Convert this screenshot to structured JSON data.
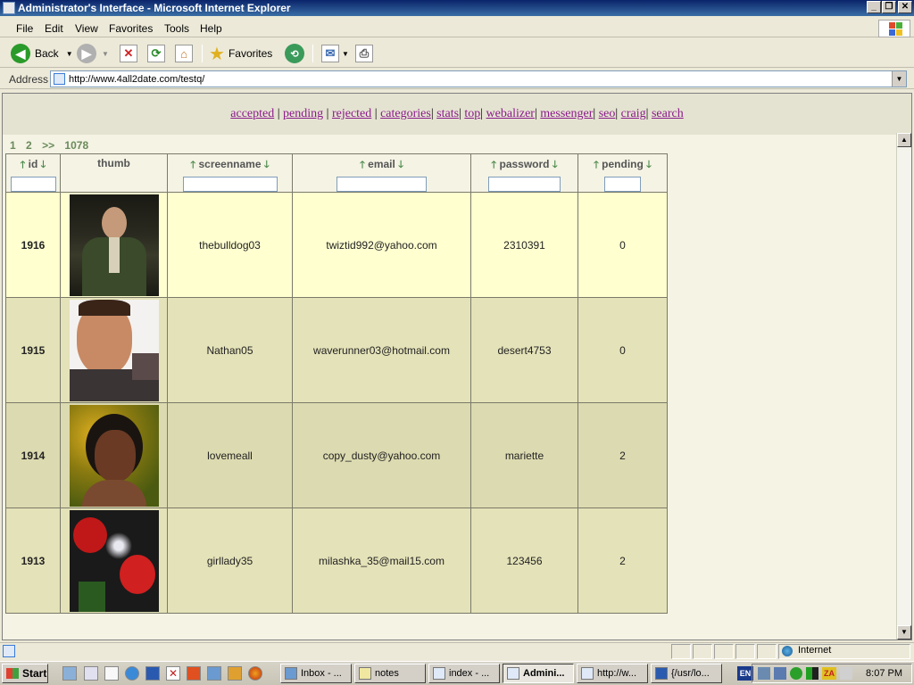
{
  "window": {
    "title": "Administrator's Interface - Microsoft Internet Explorer"
  },
  "menu": [
    "File",
    "Edit",
    "View",
    "Favorites",
    "Tools",
    "Help"
  ],
  "toolbar": {
    "back_label": "Back",
    "favorites_label": "Favorites"
  },
  "address": {
    "label": "Address",
    "url": "http://www.4all2date.com/testq/"
  },
  "nav_links": [
    "accepted",
    "pending",
    "rejected",
    "categories",
    "stats",
    "top",
    "webalizer",
    "messenger",
    "seo",
    "craig",
    "search"
  ],
  "pager": [
    "1",
    "2",
    ">>",
    "1078"
  ],
  "table": {
    "columns": [
      "id",
      "thumb",
      "screenname",
      "email",
      "password",
      "pending"
    ],
    "rows": [
      {
        "id": "1916",
        "thumb": "man-in-uniform-photo",
        "screenname": "thebulldog03",
        "email": "twiztid992@yahoo.com",
        "password": "2310391",
        "pending": "0"
      },
      {
        "id": "1915",
        "thumb": "man-portrait-photo",
        "screenname": "Nathan05",
        "email": "waverunner03@hotmail.com",
        "password": "desert4753",
        "pending": "0"
      },
      {
        "id": "1914",
        "thumb": "woman-portrait-photo",
        "screenname": "lovemeall",
        "email": "copy_dusty@yahoo.com",
        "password": "mariette",
        "pending": "2"
      },
      {
        "id": "1913",
        "thumb": "red-roses-photo",
        "screenname": "girllady35",
        "email": "milashka_35@mail15.com",
        "password": "123456",
        "pending": "2"
      }
    ],
    "row_colors": [
      "#ffffd0",
      "#e4e2b8",
      "#dcdab0",
      "#e4e2b8"
    ]
  },
  "status": {
    "zone": "Internet"
  },
  "taskbar": {
    "start_label": "Start",
    "tasks": [
      "Inbox - ...",
      "notes",
      "index - ...",
      "Admini...",
      "http://w...",
      "{/usr/lo..."
    ],
    "active_task": "Admini...",
    "lang": "EN",
    "clock": "8:07 PM"
  }
}
